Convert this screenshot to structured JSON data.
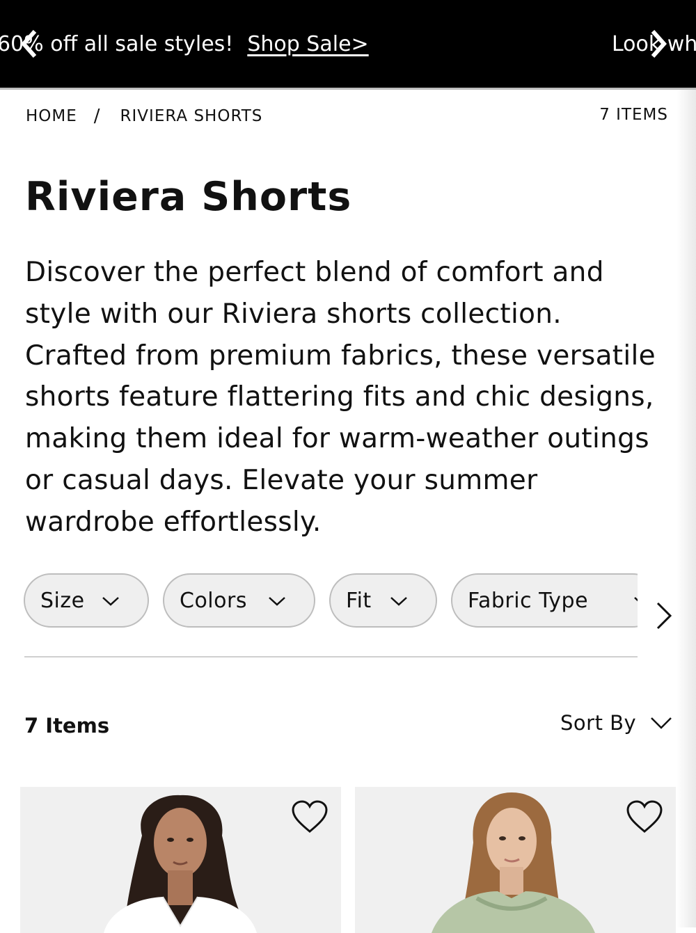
{
  "promo": {
    "left_text": "60% off all sale styles!",
    "left_link": "Shop Sale>",
    "right_text": "Look wh"
  },
  "breadcrumb": {
    "home": "HOME",
    "separator": "/",
    "current": "RIVIERA SHORTS"
  },
  "header_count": "7 ITEMS",
  "page_title": "Riviera Shorts",
  "description": "Discover the perfect blend of comfort and style with our Riviera shorts collection. Crafted from premium fabrics, these versatile shorts feature flattering fits and chic designs, making them ideal for warm-weather outings or casual days. Elevate your summer wardrobe effortlessly.",
  "filters": [
    {
      "label": "Size"
    },
    {
      "label": "Colors"
    },
    {
      "label": "Fit"
    },
    {
      "label": "Fabric Type"
    }
  ],
  "list_count": "7 Items",
  "sort_label": "Sort By",
  "icons": {
    "promo_prev": "chevron-left-icon",
    "promo_next": "chevron-right-icon",
    "filter_chevron": "chevron-down-icon",
    "filters_next": "chevron-right-icon",
    "sort_chevron": "chevron-down-icon",
    "wishlist": "heart-icon"
  },
  "colors": {
    "promo_bg": "#000000",
    "text": "#111111",
    "chip_bg": "#efefef",
    "chip_border": "#bdbdbd"
  }
}
